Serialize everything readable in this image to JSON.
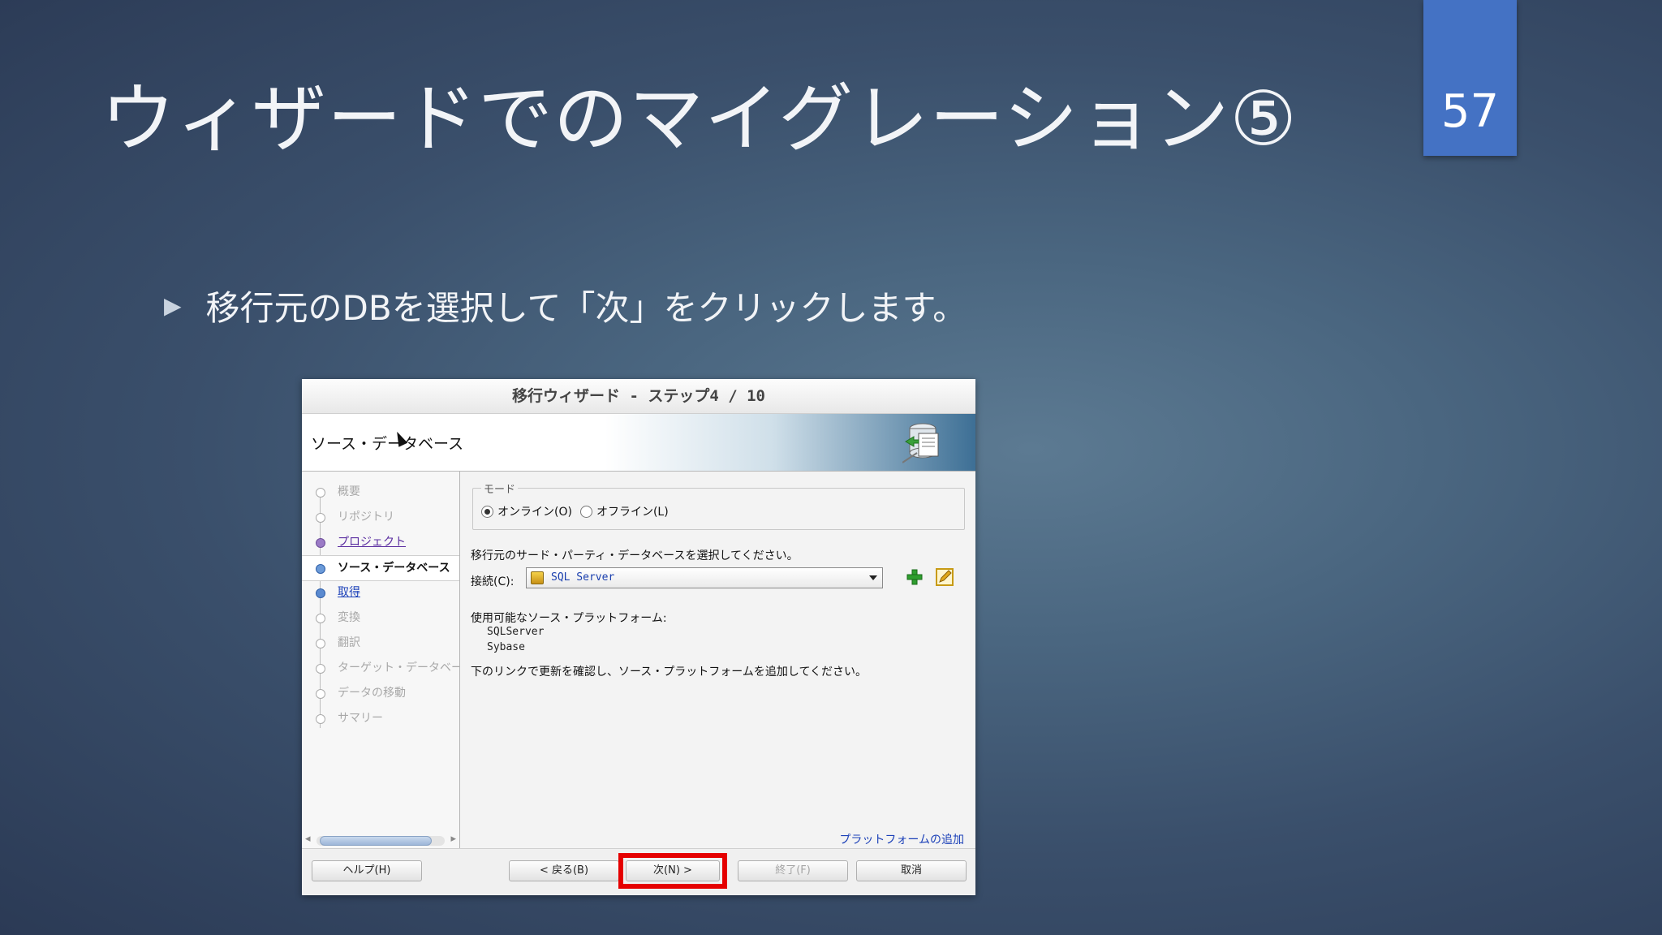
{
  "slide": {
    "title": "ウィザードでのマイグレーション⑤",
    "page_number": "57",
    "bullet_icon": "triangle-bullet-icon",
    "bullet_text": "移行元のDBを選択して「次」をクリックします。",
    "accent_color": "#4472c4"
  },
  "wizard": {
    "title": "移行ウィザード - ステップ4 / 10",
    "header_title": "ソース・データベース",
    "steps": [
      {
        "label": "概要",
        "state": "disabled"
      },
      {
        "label": "リポジトリ",
        "state": "disabled"
      },
      {
        "label": "プロジェクト",
        "state": "done"
      },
      {
        "label": "ソース・データベース",
        "state": "current"
      },
      {
        "label": "取得",
        "state": "link"
      },
      {
        "label": "変換",
        "state": "disabled"
      },
      {
        "label": "翻訳",
        "state": "disabled"
      },
      {
        "label": "ターゲット・データベース",
        "state": "disabled"
      },
      {
        "label": "データの移動",
        "state": "disabled"
      },
      {
        "label": "サマリー",
        "state": "disabled"
      }
    ],
    "mode": {
      "legend": "モード",
      "online_label": "オンライン(O)",
      "offline_label": "オフライン(L)",
      "selected": "online"
    },
    "instruction": "移行元のサード・パーティ・データベースを選択してください。",
    "connection": {
      "label": "接続(C):",
      "value": "SQL Server"
    },
    "platforms": {
      "label": "使用可能なソース・プラットフォーム:",
      "items": [
        "SQLServer",
        "Sybase"
      ]
    },
    "update_text": "下のリンクで更新を確認し、ソース・プラットフォームを追加してください。",
    "add_platform_link": "プラットフォームの追加",
    "buttons": {
      "help": "ヘルプ(H)",
      "back": "< 戻る(B)",
      "next": "次(N) >",
      "finish": "終了(F)",
      "cancel": "取消"
    },
    "highlight_color": "#e50000"
  }
}
